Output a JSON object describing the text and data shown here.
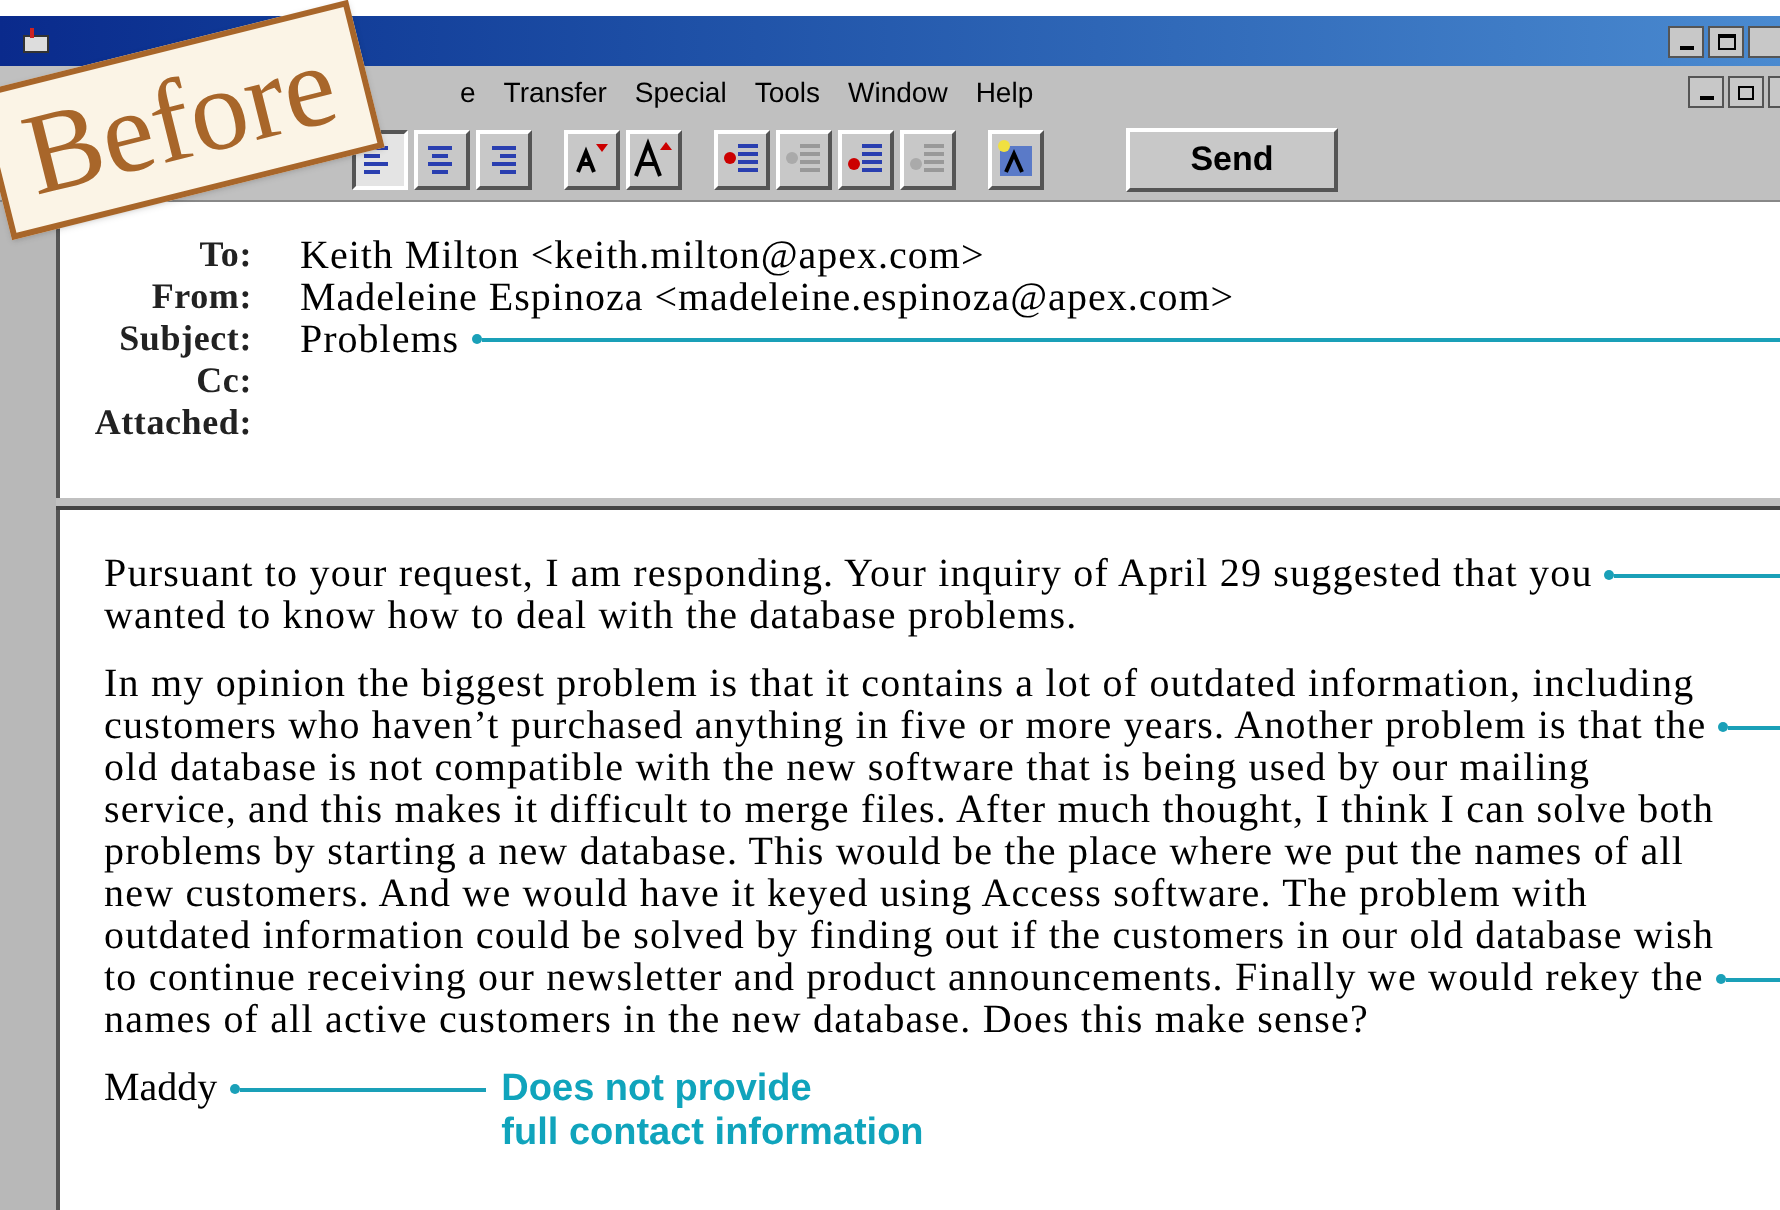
{
  "stamp": "Before",
  "menu": [
    "e",
    "Transfer",
    "Special",
    "Tools",
    "Window",
    "Help"
  ],
  "toolbar": [
    {
      "kind": "align-left",
      "pressed": true
    },
    {
      "kind": "align-center",
      "pressed": false
    },
    {
      "kind": "align-right",
      "pressed": false
    },
    {
      "kind": "gap"
    },
    {
      "kind": "font-smaller",
      "pressed": false
    },
    {
      "kind": "font-larger",
      "pressed": false
    },
    {
      "kind": "gap"
    },
    {
      "kind": "bullets",
      "pressed": false
    },
    {
      "kind": "outdent",
      "pressed": false
    },
    {
      "kind": "numbered",
      "pressed": false
    },
    {
      "kind": "indent",
      "pressed": false
    },
    {
      "kind": "gap"
    },
    {
      "kind": "insert-picture",
      "pressed": false
    }
  ],
  "send_button": "Send",
  "header_fields": [
    {
      "label": "To:",
      "value": "Keith Milton <keith.milton@apex.com>",
      "leader": false
    },
    {
      "label": "From:",
      "value": "Madeleine Espinoza <madeleine.espinoza@apex.com>",
      "leader": false
    },
    {
      "label": "Subject:",
      "value": "Problems",
      "leader": true
    },
    {
      "label": "Cc:",
      "leader": false
    },
    {
      "label": "Attached:",
      "leader": false
    }
  ],
  "body": [
    [
      {
        "text": "Pursuant to your request, I am responding. Your inquiry of April 29 suggested that you",
        "leader": true
      },
      {
        "text": "wanted to know how to deal with the database problems.",
        "leader": false
      }
    ],
    [
      {
        "text": "In my opinion the biggest problem is that it contains a lot of outdated information, including",
        "leader": false
      },
      {
        "text": "customers who haven’t purchased anything in five or more years. Another problem is that the",
        "leader": true
      },
      {
        "text": "old database is not compatible with the new software that is being used by our mailing",
        "leader": false
      },
      {
        "text": "service, and this makes it difficult to merge files. After much thought, I think I can solve both",
        "leader": false
      },
      {
        "text": "problems by starting a new database. This would be the place where we put the names of all",
        "leader": false
      },
      {
        "text": "new customers. And we would have it keyed using Access software. The problem with",
        "leader": false
      },
      {
        "text": "outdated information could be solved by finding out if the customers in our old database wish",
        "leader": false
      },
      {
        "text": "to continue receiving our newsletter and product announcements. Finally we would rekey the",
        "leader": true
      },
      {
        "text": "names of all active customers in the new database. Does this make sense?",
        "leader": false
      }
    ]
  ],
  "signature": "Maddy",
  "callout": [
    "Does not provide",
    "full contact information"
  ]
}
